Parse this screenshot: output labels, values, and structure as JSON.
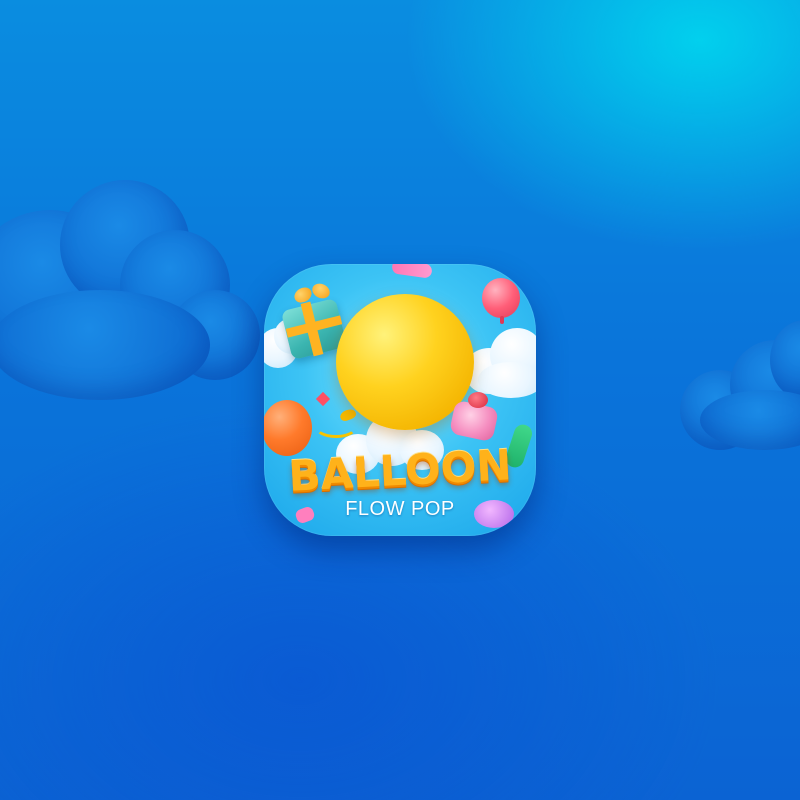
{
  "app_icon": {
    "icon_name": "balloon-flow-pop-app-icon",
    "title": "BALLOON",
    "subtitle": "FLOW POP"
  },
  "colors": {
    "background_top": "#0a8de0",
    "background_bottom": "#0b63d3",
    "accent_cyan": "#00dcf0",
    "icon_sky": "#3dc4f5",
    "balloon_yellow": "#ffd21f",
    "title_orange": "#ffb21a"
  }
}
